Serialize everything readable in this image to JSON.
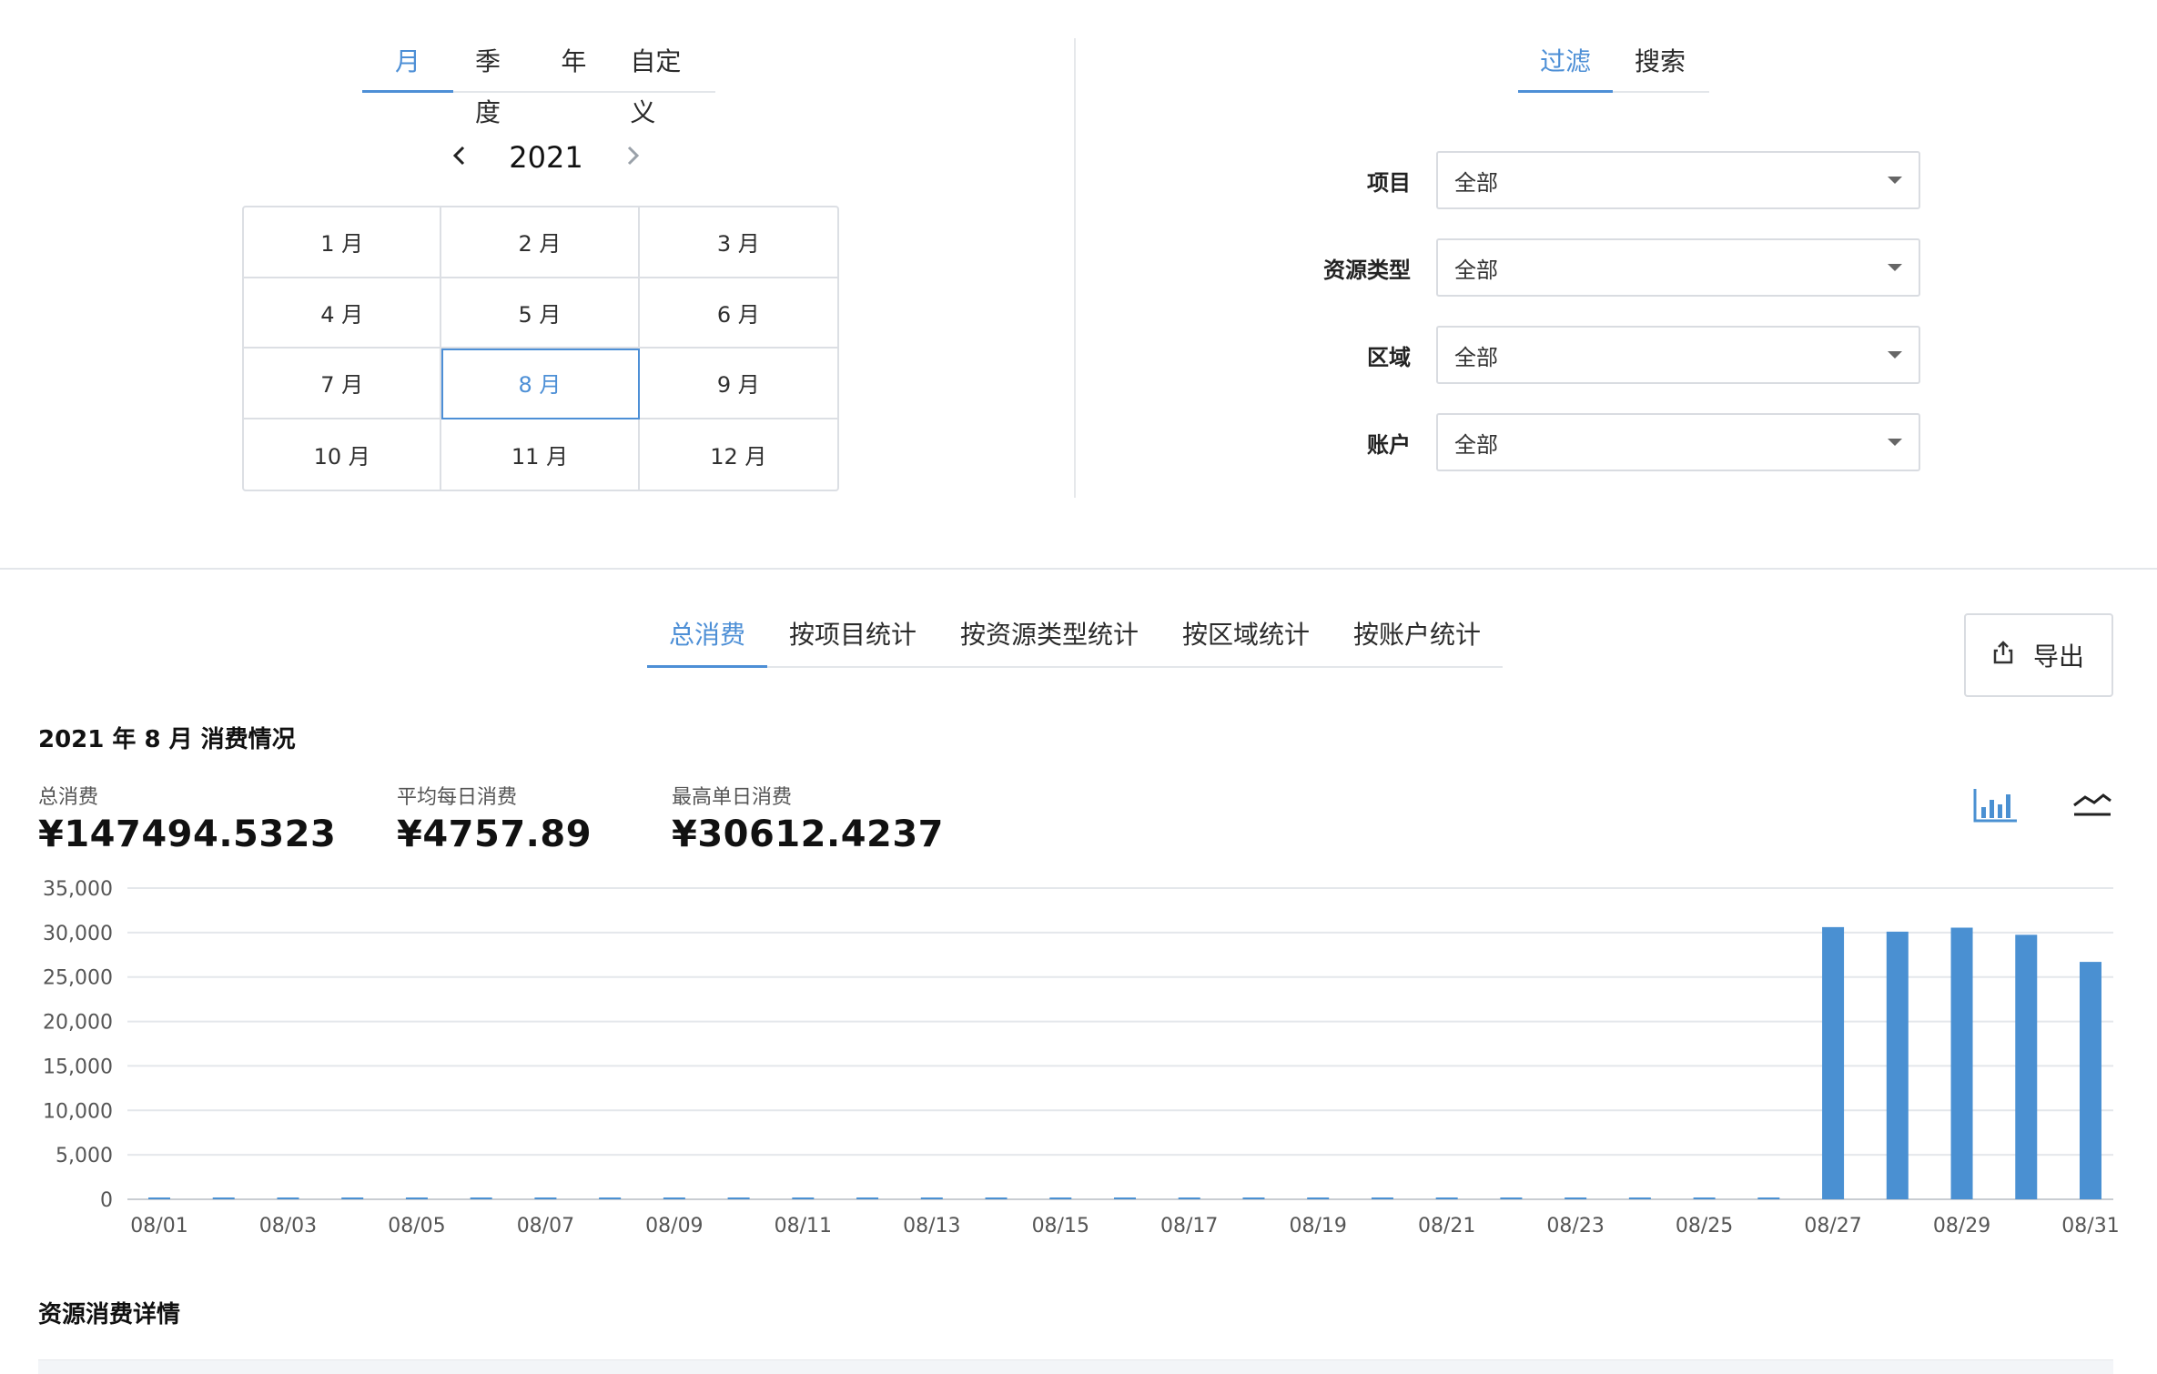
{
  "period": {
    "tabs": [
      "月",
      "季度",
      "年",
      "自定义"
    ],
    "active_tab": 0,
    "year": "2021",
    "prev_icon": "chevron-left-icon",
    "next_icon": "chevron-right-icon",
    "months": [
      "1 月",
      "2 月",
      "3 月",
      "4 月",
      "5 月",
      "6 月",
      "7 月",
      "8 月",
      "9 月",
      "10 月",
      "11 月",
      "12 月"
    ],
    "selected_month_index": 7
  },
  "filter": {
    "tabs": [
      "过滤",
      "搜索"
    ],
    "active_tab": 0,
    "fields": [
      {
        "label": "项目",
        "value": "全部"
      },
      {
        "label": "资源类型",
        "value": "全部"
      },
      {
        "label": "区域",
        "value": "全部"
      },
      {
        "label": "账户",
        "value": "全部"
      }
    ]
  },
  "stats": {
    "tabs": [
      "总消费",
      "按项目统计",
      "按资源类型统计",
      "按区域统计",
      "按账户统计"
    ],
    "active_tab": 0,
    "export_label": "导出",
    "export_icon": "share-icon",
    "title": "2021 年 8 月 消费情况",
    "metrics": [
      {
        "label": "总消费",
        "value": "¥147494.5323"
      },
      {
        "label": "平均每日消费",
        "value": "¥4757.89"
      },
      {
        "label": "最高单日消费",
        "value": "¥30612.4237"
      }
    ],
    "chart_toggle_icons": [
      "bar-chart-icon",
      "line-chart-icon"
    ],
    "accent_color": "#4a90d2",
    "detail_title": "资源消费详情"
  },
  "chart_data": {
    "type": "bar",
    "categories": [
      "08/01",
      "08/02",
      "08/03",
      "08/04",
      "08/05",
      "08/06",
      "08/07",
      "08/08",
      "08/09",
      "08/10",
      "08/11",
      "08/12",
      "08/13",
      "08/14",
      "08/15",
      "08/16",
      "08/17",
      "08/18",
      "08/19",
      "08/20",
      "08/21",
      "08/22",
      "08/23",
      "08/24",
      "08/25",
      "08/26",
      "08/27",
      "08/28",
      "08/29",
      "08/30",
      "08/31"
    ],
    "x_tick_labels": [
      "08/01",
      "08/03",
      "08/05",
      "08/07",
      "08/09",
      "08/11",
      "08/13",
      "08/15",
      "08/17",
      "08/19",
      "08/21",
      "08/23",
      "08/25",
      "08/27",
      "08/29",
      "08/31"
    ],
    "values": [
      0.5,
      0.5,
      0.5,
      0.5,
      0.5,
      0.5,
      0.5,
      0.5,
      0.5,
      0.5,
      0.5,
      0.5,
      0.5,
      0.5,
      0.5,
      0.5,
      0.5,
      0.5,
      0.5,
      0.5,
      0.5,
      0.5,
      0.5,
      0.5,
      0.5,
      0.5,
      30612.4237,
      30100,
      30550,
      29750,
      26700
    ],
    "y_ticks": [
      "0",
      "5,000",
      "10,000",
      "15,000",
      "20,000",
      "25,000",
      "30,000",
      "35,000"
    ],
    "ylim": [
      0,
      35000
    ],
    "grid": true,
    "bar_color": "#4a90d2"
  }
}
